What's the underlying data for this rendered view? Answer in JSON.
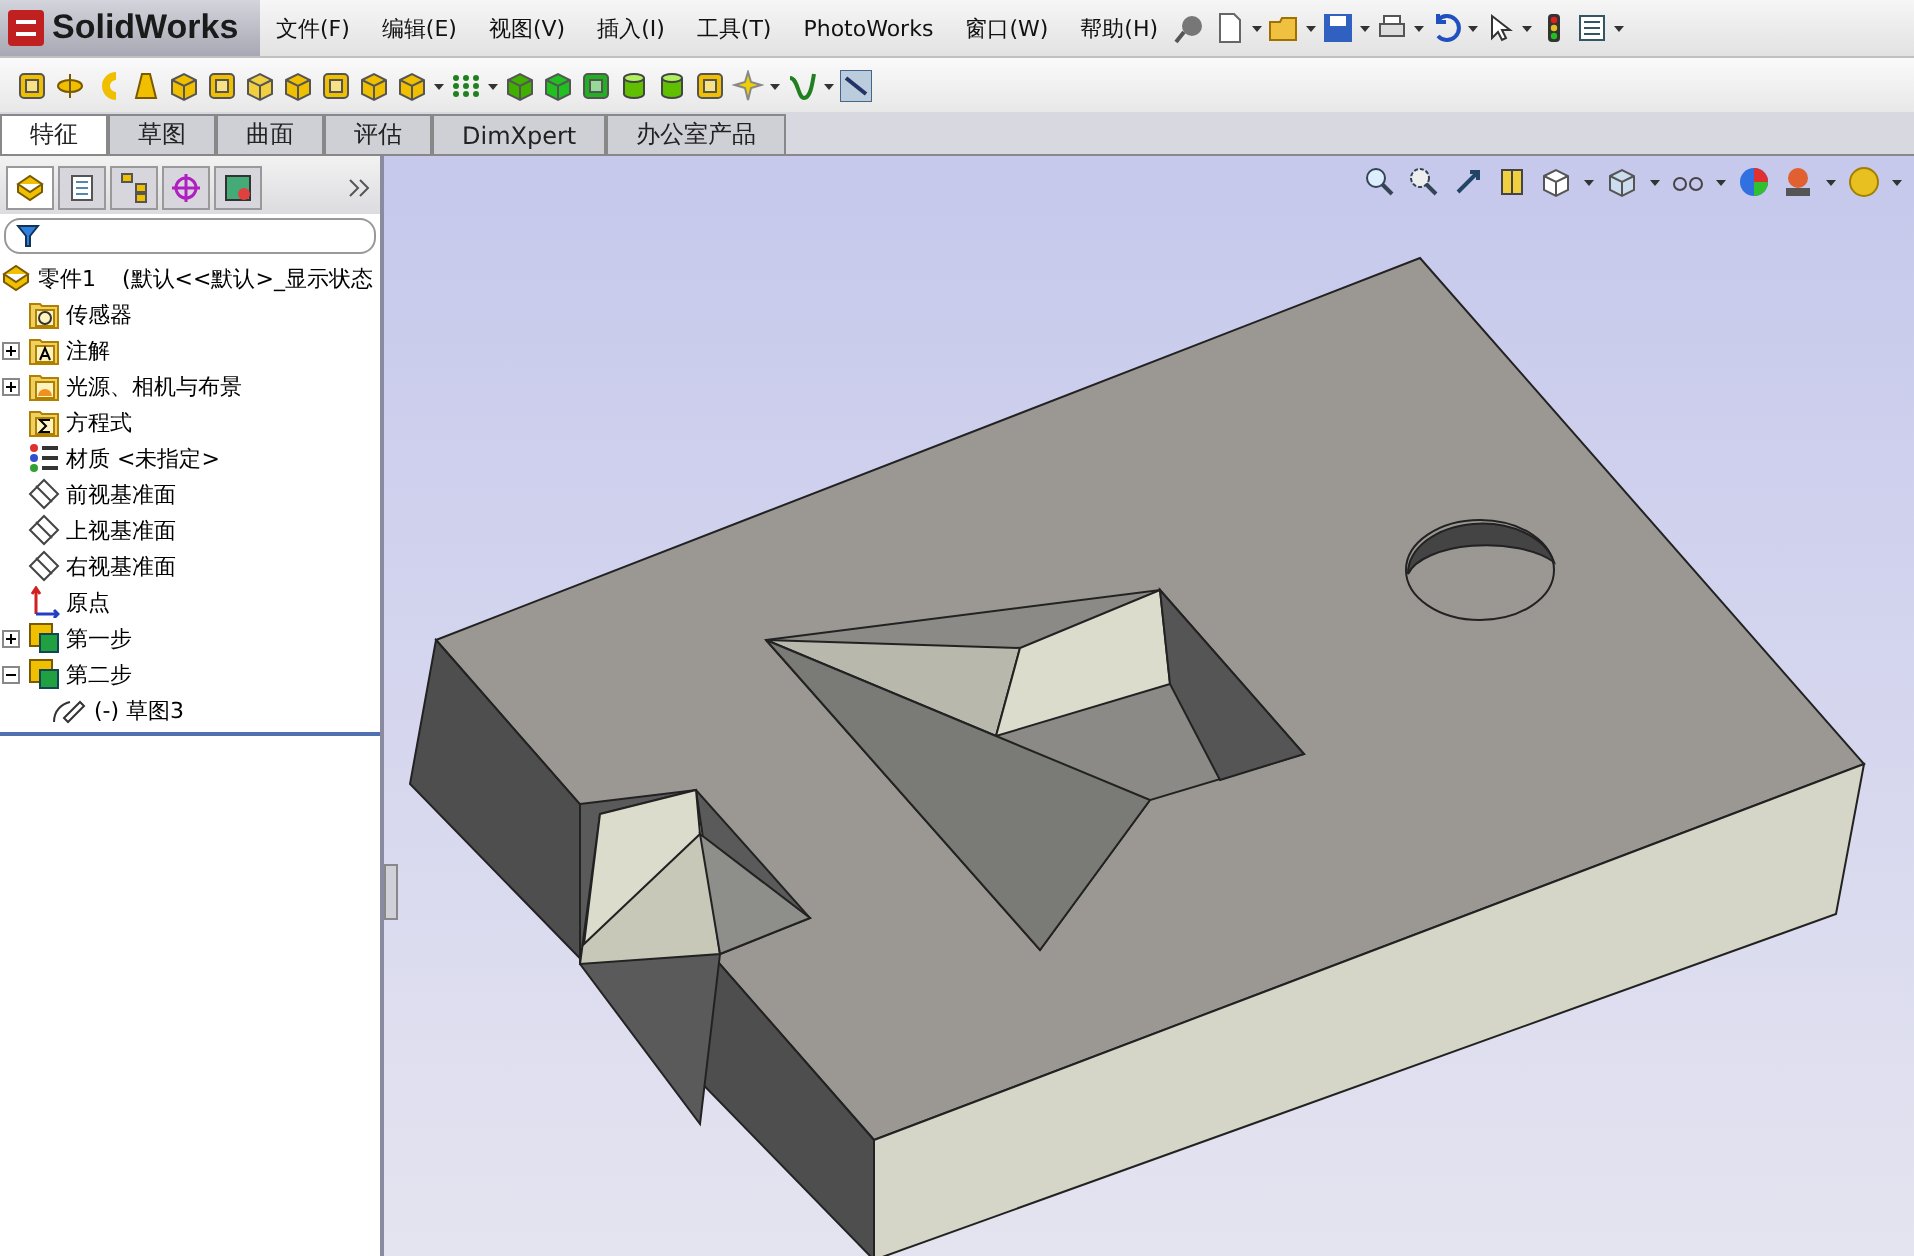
{
  "app": {
    "name": "SolidWorks"
  },
  "menu": [
    {
      "label": "文件(F)"
    },
    {
      "label": "编辑(E)"
    },
    {
      "label": "视图(V)"
    },
    {
      "label": "插入(I)"
    },
    {
      "label": "工具(T)"
    },
    {
      "label": "PhotoWorks"
    },
    {
      "label": "窗口(W)"
    },
    {
      "label": "帮助(H)"
    }
  ],
  "command_tabs": [
    {
      "label": "特征",
      "selected": true
    },
    {
      "label": "草图",
      "selected": false
    },
    {
      "label": "曲面",
      "selected": false
    },
    {
      "label": "评估",
      "selected": false
    },
    {
      "label": "DimXpert",
      "selected": false
    },
    {
      "label": "办公室产品",
      "selected": false
    }
  ],
  "manager_tabs": [
    {
      "kind": "feature",
      "selected": true
    },
    {
      "kind": "property",
      "selected": false
    },
    {
      "kind": "config",
      "selected": false
    },
    {
      "kind": "dimxpert",
      "selected": false
    },
    {
      "kind": "display",
      "selected": false
    }
  ],
  "tree": {
    "label": "零件1",
    "suffix": "(默认<<默认>_显示状态",
    "children": [
      {
        "label": "传感器",
        "kind": "sensor"
      },
      {
        "label": "注解",
        "kind": "annotation",
        "expanded": false
      },
      {
        "label": "光源、相机与布景",
        "kind": "lights",
        "expanded": false
      },
      {
        "label": "方程式",
        "kind": "equation"
      },
      {
        "label": "材质 <未指定>",
        "kind": "material"
      },
      {
        "label": "前视基准面",
        "kind": "plane"
      },
      {
        "label": "上视基准面",
        "kind": "plane"
      },
      {
        "label": "右视基准面",
        "kind": "plane"
      },
      {
        "label": "原点",
        "kind": "origin"
      },
      {
        "label": "第一步",
        "kind": "feature",
        "expanded": false
      },
      {
        "label": "第二步",
        "kind": "feature",
        "expanded": true,
        "children": [
          {
            "label": "(-) 草图3",
            "kind": "sketch"
          }
        ]
      }
    ]
  }
}
